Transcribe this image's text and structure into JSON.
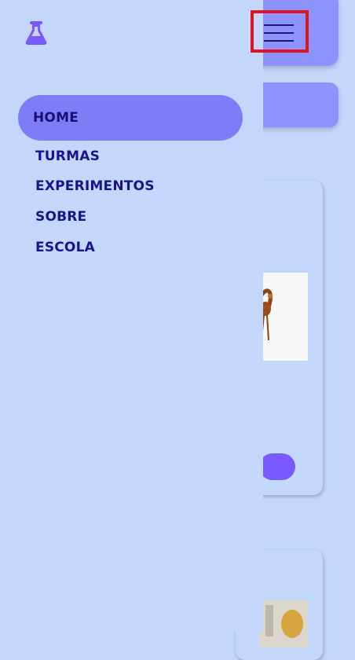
{
  "app": {
    "logo_icon": "flask-icon",
    "menu_icon": "hamburger-menu-icon"
  },
  "nav": {
    "items": [
      {
        "label": "HOME",
        "active": true
      },
      {
        "label": "TURMAS",
        "active": false
      },
      {
        "label": "EXPERIMENTOS",
        "active": false
      },
      {
        "label": "SOBRE",
        "active": false
      },
      {
        "label": "ESCOLA",
        "active": false
      }
    ]
  },
  "colors": {
    "drawer_bg": "#c2d7fb",
    "accent": "#7a58ff",
    "active_pill": "#7f7cf8",
    "nav_text": "#1b1290",
    "highlight": "#e3121f"
  }
}
